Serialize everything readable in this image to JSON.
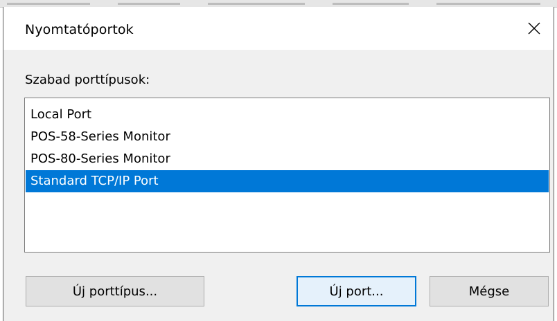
{
  "dialog": {
    "title": "Nyomtatóportok",
    "close_icon": "close-icon",
    "close_glyph": "✕"
  },
  "port_types": {
    "label": "Szabad porttípusok:",
    "items": [
      {
        "label": "Local Port",
        "selected": false
      },
      {
        "label": "POS-58-Series Monitor",
        "selected": false
      },
      {
        "label": "POS-80-Series Monitor",
        "selected": false
      },
      {
        "label": "Standard TCP/IP Port",
        "selected": true
      }
    ]
  },
  "buttons": {
    "new_port_type": "Új porttípus...",
    "new_port": "Új port...",
    "cancel": "Mégse"
  },
  "colors": {
    "selection": "#0078d7",
    "dialog_background": "#f0f0f0",
    "default_button_fill": "#e5f1fb"
  }
}
